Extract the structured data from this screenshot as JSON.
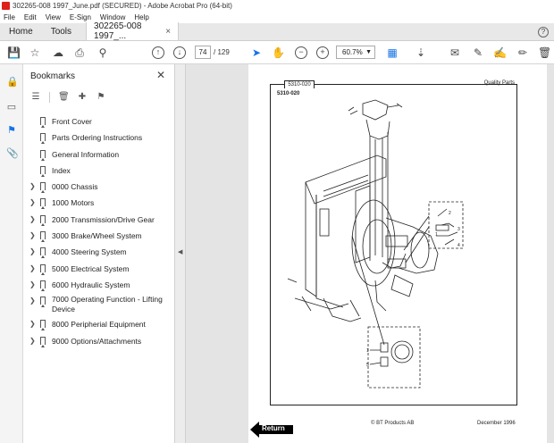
{
  "window": {
    "title": "302265-008 1997_June.pdf (SECURED) - Adobe Acrobat Pro (64-bit)"
  },
  "menu": [
    "File",
    "Edit",
    "View",
    "E-Sign",
    "Window",
    "Help"
  ],
  "tabs": {
    "home": "Home",
    "tools": "Tools",
    "document": "302265-008 1997_...",
    "close": "×"
  },
  "toolbar": {
    "page_current": "74",
    "page_total": "/ 129",
    "zoom": "60.7%"
  },
  "bookmarks": {
    "title": "Bookmarks",
    "items": [
      {
        "label": "Front Cover",
        "expandable": false
      },
      {
        "label": "Parts Ordering Instructions",
        "expandable": false
      },
      {
        "label": "General Information",
        "expandable": false
      },
      {
        "label": "Index",
        "expandable": false
      },
      {
        "label": "0000 Chassis",
        "expandable": true
      },
      {
        "label": "1000 Motors",
        "expandable": true
      },
      {
        "label": "2000 Transmission/Drive Gear",
        "expandable": true
      },
      {
        "label": "3000 Brake/Wheel System",
        "expandable": true
      },
      {
        "label": "4000 Steering System",
        "expandable": true
      },
      {
        "label": "5000 Electrical System",
        "expandable": true
      },
      {
        "label": "6000 Hydraulic System",
        "expandable": true
      },
      {
        "label": "7000 Operating Function - Lifting Device",
        "expandable": true
      },
      {
        "label": "8000 Peripherial Equipment",
        "expandable": true
      },
      {
        "label": "9000 Options/Attachments",
        "expandable": true
      }
    ]
  },
  "document": {
    "section_box": "5310-020",
    "section_code": "5310-020",
    "header_right": "Quality Parts",
    "footer_left": "© BT Products AB",
    "footer_right": "December 1996",
    "return_label": "Return",
    "callouts": [
      "2",
      "3",
      "4",
      "1",
      "1",
      "5"
    ]
  },
  "icons": {
    "rail": [
      "lock-icon",
      "page-thumbnails-icon",
      "bookmark-icon",
      "attachment-icon"
    ],
    "accent": "#1473e6"
  }
}
